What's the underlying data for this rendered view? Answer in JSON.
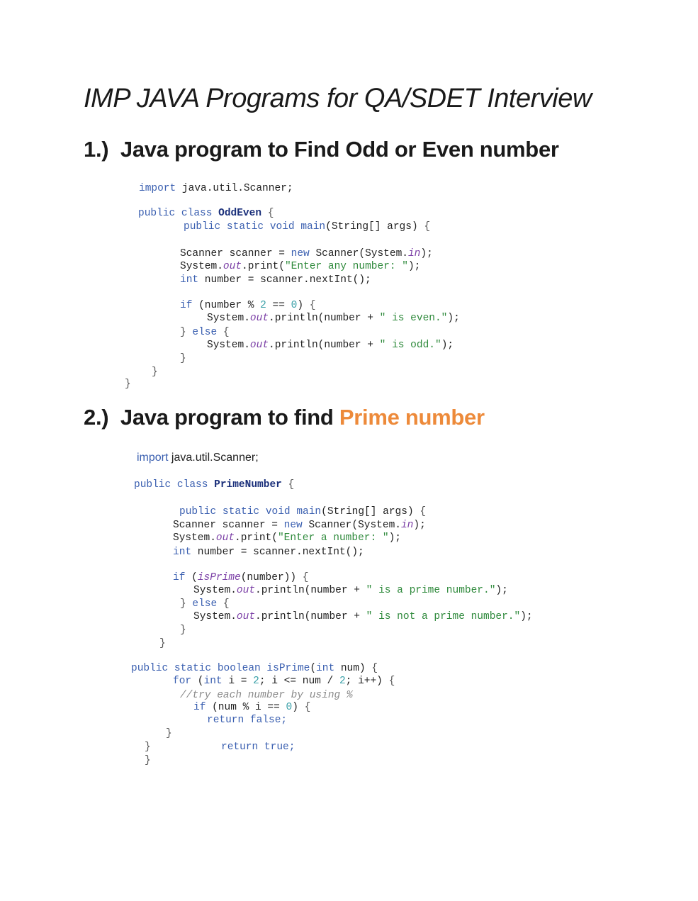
{
  "page": {
    "title": "IMP JAVA Programs for QA/SDET Interview",
    "section1": {
      "number": "1.)",
      "text": "Java program to Find Odd or Even number"
    },
    "section2": {
      "number": "2.)",
      "text": "Java program to find ",
      "highlight": "Prime number"
    }
  },
  "code1": [
    {
      "parts": [
        {
          "t": "import",
          "c": "kw"
        },
        {
          "t": " java.util.Scanner;"
        }
      ]
    },
    {
      "parts": [
        {
          "t": "public class ",
          "c": "kw"
        },
        {
          "t": "OddEven",
          "c": "cls"
        },
        {
          "t": " {",
          "c": "brace"
        }
      ]
    },
    {
      "parts": [
        {
          "t": "public static void main",
          "c": "kw"
        },
        {
          "t": "(String[] args) "
        },
        {
          "t": "{",
          "c": "brace"
        }
      ]
    },
    {
      "parts": [
        {
          "t": "Scanner scanner = "
        },
        {
          "t": "new",
          "c": "kw"
        },
        {
          "t": " Scanner(System."
        },
        {
          "t": "in",
          "c": "fld"
        },
        {
          "t": ");"
        }
      ]
    },
    {
      "parts": [
        {
          "t": "System."
        },
        {
          "t": "out",
          "c": "fld"
        },
        {
          "t": ".print("
        },
        {
          "t": "\"Enter any number: \"",
          "c": "str"
        },
        {
          "t": ");"
        }
      ]
    },
    {
      "parts": [
        {
          "t": "int",
          "c": "kw"
        },
        {
          "t": " number = scanner.nextInt();"
        }
      ]
    },
    {
      "parts": [
        {
          "t": "if",
          "c": "kw"
        },
        {
          "t": " (number % "
        },
        {
          "t": "2",
          "c": "num"
        },
        {
          "t": " == "
        },
        {
          "t": "0",
          "c": "num"
        },
        {
          "t": ") "
        },
        {
          "t": "{",
          "c": "brace"
        }
      ]
    },
    {
      "parts": [
        {
          "t": "System."
        },
        {
          "t": "out",
          "c": "fld"
        },
        {
          "t": ".println(number + "
        },
        {
          "t": "\" is even.\"",
          "c": "str"
        },
        {
          "t": ");"
        }
      ]
    },
    {
      "parts": [
        {
          "t": "} ",
          "c": "brace"
        },
        {
          "t": "else",
          "c": "kw"
        },
        {
          "t": " {",
          "c": "brace"
        }
      ]
    },
    {
      "parts": [
        {
          "t": "System."
        },
        {
          "t": "out",
          "c": "fld"
        },
        {
          "t": ".println(number + "
        },
        {
          "t": "\" is odd.\"",
          "c": "str"
        },
        {
          "t": ");"
        }
      ]
    },
    {
      "parts": [
        {
          "t": "}",
          "c": "brace"
        }
      ]
    },
    {
      "parts": [
        {
          "t": "}",
          "c": "brace"
        }
      ]
    },
    {
      "parts": [
        {
          "t": "}",
          "c": "brace"
        }
      ]
    }
  ],
  "code2": [
    {
      "parts": [
        {
          "t": "import",
          "c": "kw"
        },
        {
          "t": " java.util.Scanner;"
        }
      ]
    },
    {
      "parts": [
        {
          "t": "public class ",
          "c": "kw"
        },
        {
          "t": "PrimeNumber",
          "c": "cls"
        },
        {
          "t": " {",
          "c": "brace"
        }
      ]
    },
    {
      "parts": [
        {
          "t": "public static void main",
          "c": "kw"
        },
        {
          "t": "(String[] args) "
        },
        {
          "t": "{",
          "c": "brace"
        }
      ]
    },
    {
      "parts": [
        {
          "t": "Scanner scanner = "
        },
        {
          "t": "new",
          "c": "kw"
        },
        {
          "t": " Scanner(System."
        },
        {
          "t": "in",
          "c": "fld"
        },
        {
          "t": ");"
        }
      ]
    },
    {
      "parts": [
        {
          "t": "System."
        },
        {
          "t": "out",
          "c": "fld"
        },
        {
          "t": ".print("
        },
        {
          "t": "\"Enter a number: \"",
          "c": "str"
        },
        {
          "t": ");"
        }
      ]
    },
    {
      "parts": [
        {
          "t": "int",
          "c": "kw"
        },
        {
          "t": " number = scanner.nextInt();"
        }
      ]
    },
    {
      "parts": [
        {
          "t": "if",
          "c": "kw"
        },
        {
          "t": " ("
        },
        {
          "t": "isPrime",
          "c": "fld"
        },
        {
          "t": "(number)) "
        },
        {
          "t": "{",
          "c": "brace"
        }
      ]
    },
    {
      "parts": [
        {
          "t": "System."
        },
        {
          "t": "out",
          "c": "fld"
        },
        {
          "t": ".println(number + "
        },
        {
          "t": "\" is a prime number.\"",
          "c": "str"
        },
        {
          "t": ");"
        }
      ]
    },
    {
      "parts": [
        {
          "t": "} ",
          "c": "brace"
        },
        {
          "t": "else",
          "c": "kw"
        },
        {
          "t": " {",
          "c": "brace"
        }
      ]
    },
    {
      "parts": [
        {
          "t": "System."
        },
        {
          "t": "out",
          "c": "fld"
        },
        {
          "t": ".println(number + "
        },
        {
          "t": "\" is not a prime number.\"",
          "c": "str"
        },
        {
          "t": ");"
        }
      ]
    },
    {
      "parts": [
        {
          "t": "}",
          "c": "brace"
        }
      ]
    },
    {
      "parts": [
        {
          "t": "}",
          "c": "brace"
        }
      ]
    },
    {
      "parts": [
        {
          "t": "public static boolean isPrime",
          "c": "kw"
        },
        {
          "t": "("
        },
        {
          "t": "int",
          "c": "kw"
        },
        {
          "t": " num) "
        },
        {
          "t": "{",
          "c": "brace"
        }
      ]
    },
    {
      "parts": [
        {
          "t": "for",
          "c": "kw"
        },
        {
          "t": " ("
        },
        {
          "t": "int",
          "c": "kw"
        },
        {
          "t": " i = "
        },
        {
          "t": "2",
          "c": "num"
        },
        {
          "t": "; i <= num / "
        },
        {
          "t": "2",
          "c": "num"
        },
        {
          "t": "; i++) "
        },
        {
          "t": "{",
          "c": "brace"
        }
      ]
    },
    {
      "parts": [
        {
          "t": "//try each number by using %",
          "c": "cmt"
        }
      ]
    },
    {
      "parts": [
        {
          "t": "if",
          "c": "kw"
        },
        {
          "t": " (num % i == "
        },
        {
          "t": "0",
          "c": "num"
        },
        {
          "t": ") "
        },
        {
          "t": "{",
          "c": "brace"
        }
      ]
    },
    {
      "parts": [
        {
          "t": "return false;",
          "c": "kw"
        }
      ]
    },
    {
      "parts": [
        {
          "t": "}",
          "c": "brace"
        }
      ]
    },
    {
      "parts": [
        {
          "t": "}",
          "c": "brace"
        }
      ]
    },
    {
      "parts": [
        {
          "t": "return true;",
          "c": "kw"
        }
      ]
    },
    {
      "parts": [
        {
          "t": "}",
          "c": "brace"
        }
      ]
    }
  ]
}
